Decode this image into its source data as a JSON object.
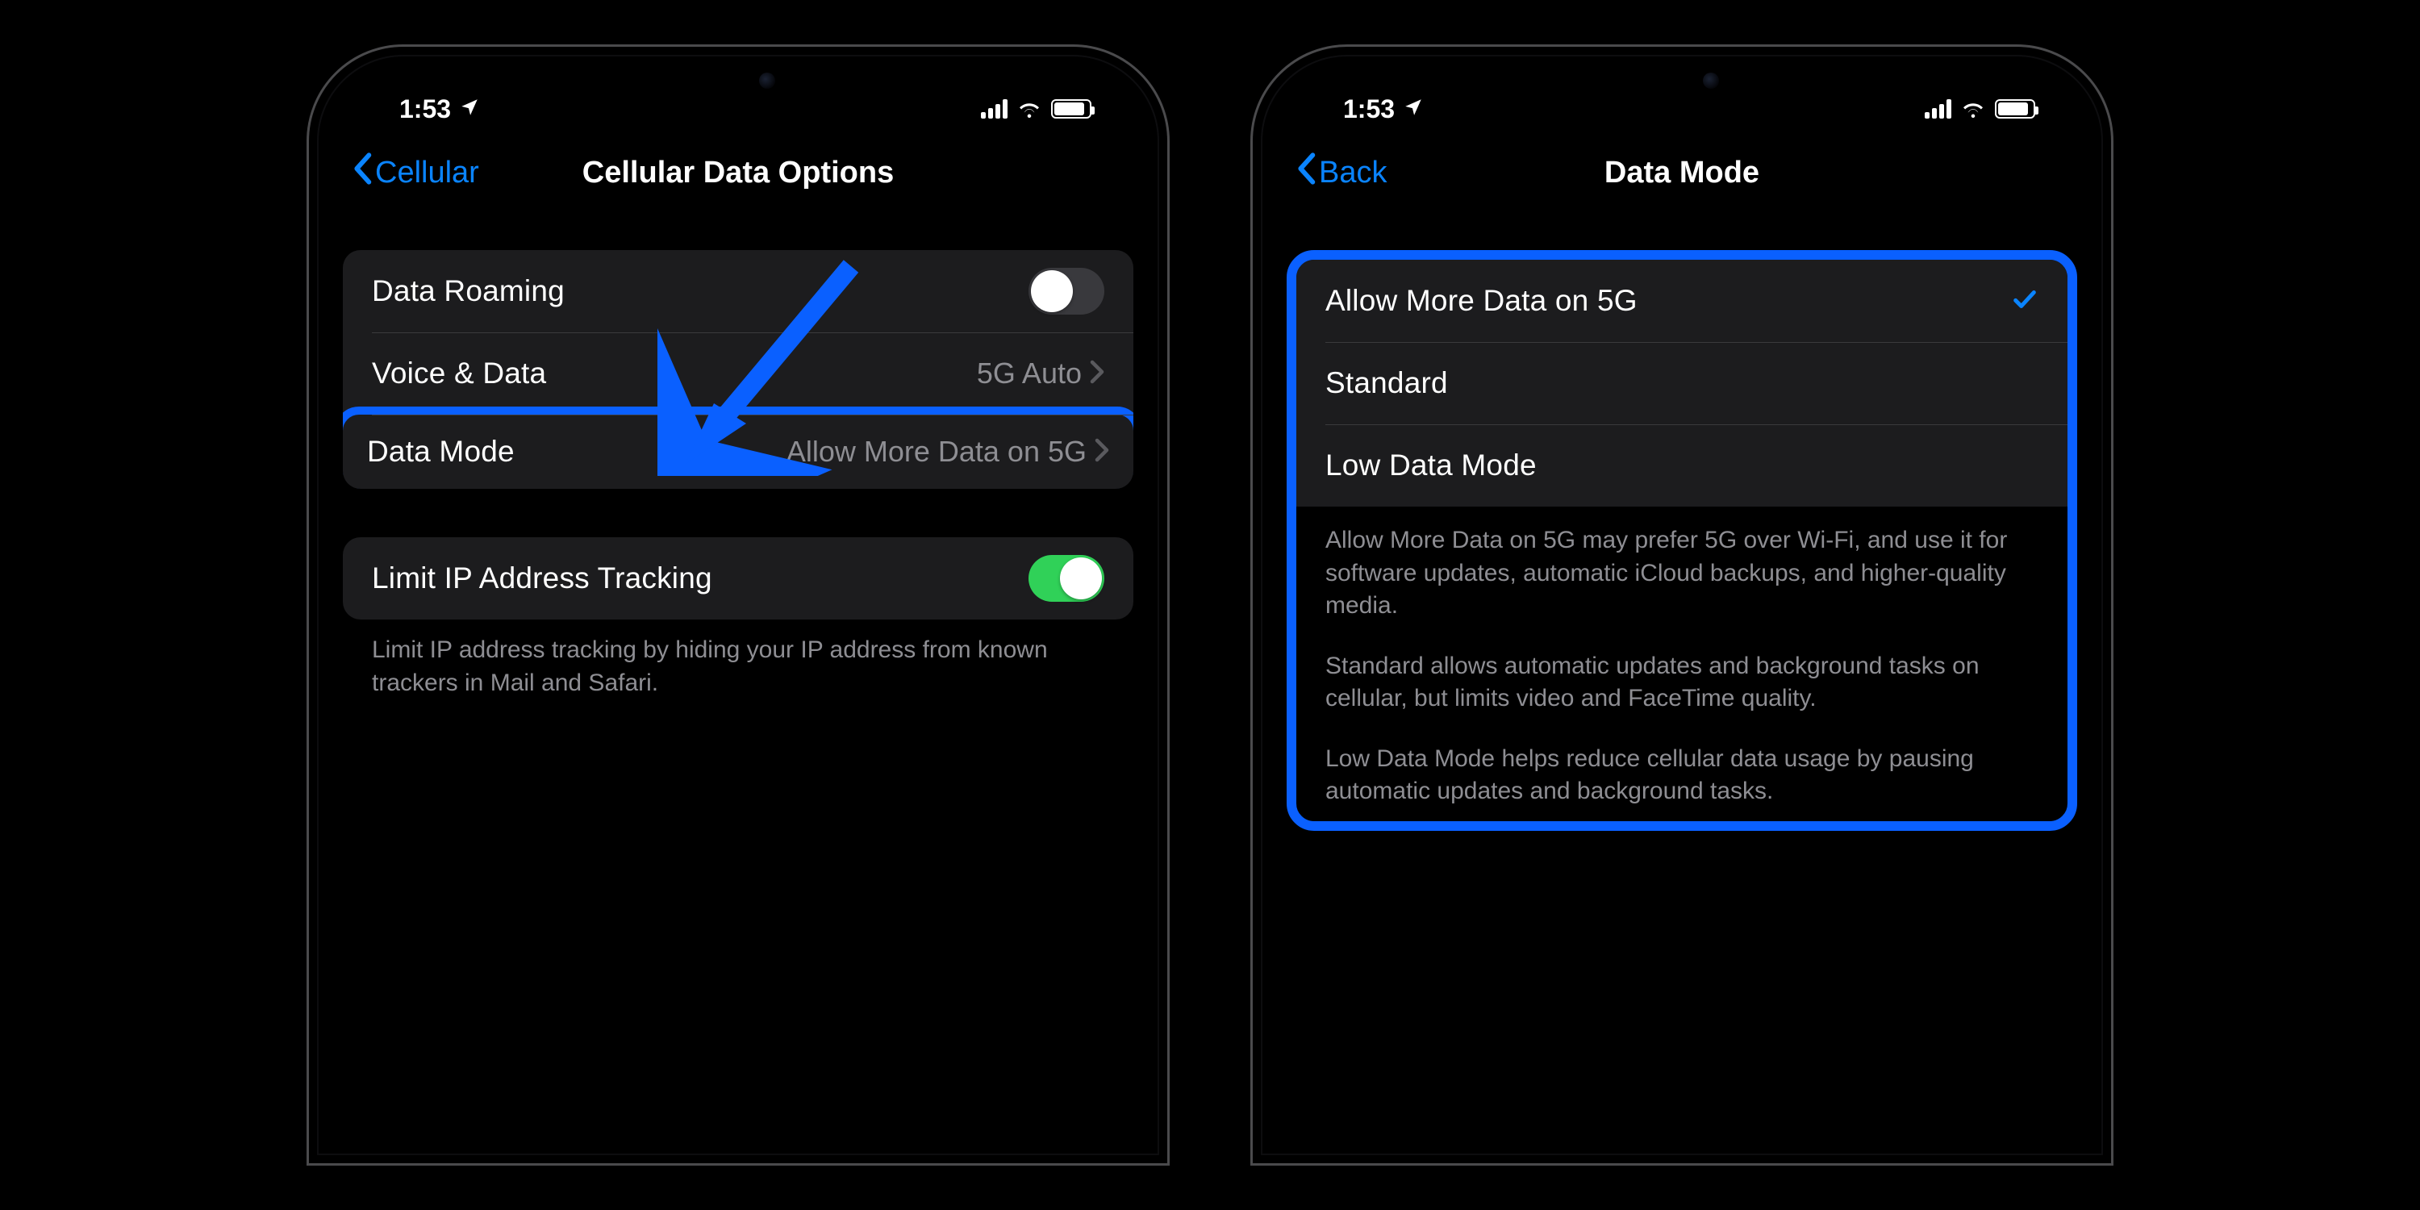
{
  "status": {
    "time": "1:53"
  },
  "colors": {
    "accent": "#0a84ff",
    "highlight": "#0a60ff",
    "switch_on": "#30d158"
  },
  "phone1": {
    "nav": {
      "back": "Cellular",
      "title": "Cellular Data Options"
    },
    "rows": {
      "roaming": {
        "label": "Data Roaming",
        "on": false
      },
      "voice": {
        "label": "Voice & Data",
        "value": "5G Auto"
      },
      "mode": {
        "label": "Data Mode",
        "value": "Allow More Data on 5G"
      },
      "limitip": {
        "label": "Limit IP Address Tracking",
        "on": true
      }
    },
    "footer_limitip": "Limit IP address tracking by hiding your IP address from known trackers in Mail and Safari."
  },
  "phone2": {
    "nav": {
      "back": "Back",
      "title": "Data Mode"
    },
    "options": [
      {
        "label": "Allow More Data on 5G",
        "selected": true
      },
      {
        "label": "Standard",
        "selected": false
      },
      {
        "label": "Low Data Mode",
        "selected": false
      }
    ],
    "footer_p1": "Allow More Data on 5G may prefer 5G over Wi-Fi, and use it for software updates, automatic iCloud backups, and higher-quality media.",
    "footer_p2": "Standard allows automatic updates and background tasks on cellular, but limits video and FaceTime quality.",
    "footer_p3": "Low Data Mode helps reduce cellular data usage by pausing automatic updates and background tasks."
  }
}
